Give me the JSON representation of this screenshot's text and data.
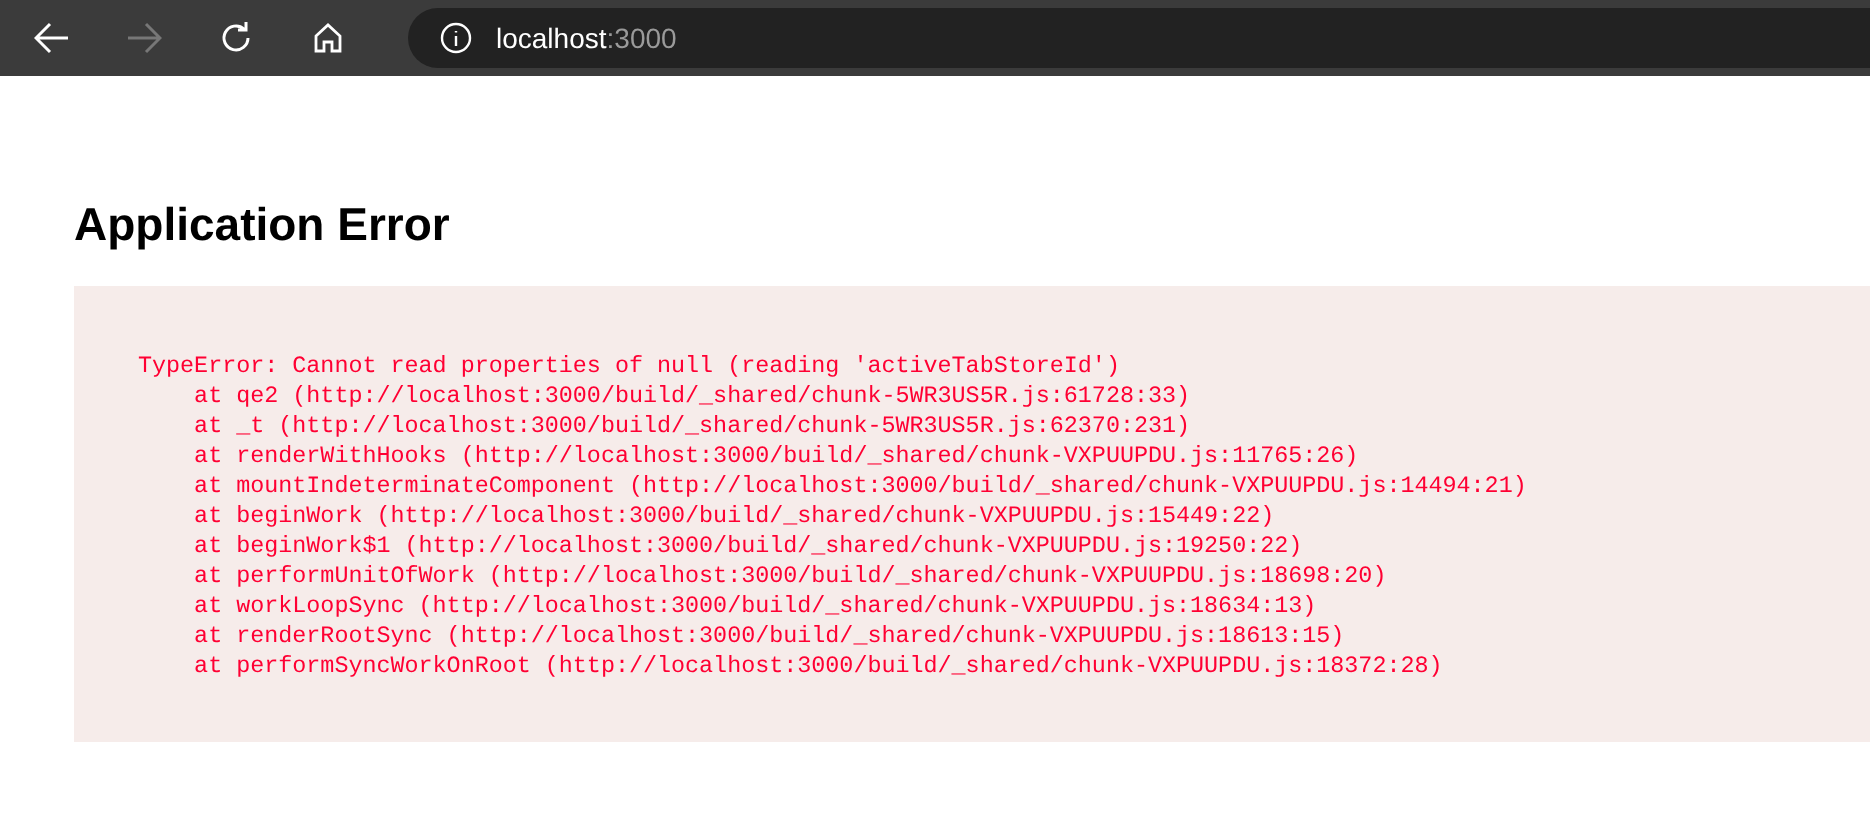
{
  "browser": {
    "address_host": "localhost",
    "address_port": ":3000",
    "forward_disabled": true
  },
  "heading": "Application Error",
  "error_lines": [
    "TypeError: Cannot read properties of null (reading 'activeTabStoreId')",
    "    at qe2 (http://localhost:3000/build/_shared/chunk-5WR3US5R.js:61728:33)",
    "    at _t (http://localhost:3000/build/_shared/chunk-5WR3US5R.js:62370:231)",
    "    at renderWithHooks (http://localhost:3000/build/_shared/chunk-VXPUUPDU.js:11765:26)",
    "    at mountIndeterminateComponent (http://localhost:3000/build/_shared/chunk-VXPUUPDU.js:14494:21)",
    "    at beginWork (http://localhost:3000/build/_shared/chunk-VXPUUPDU.js:15449:22)",
    "    at beginWork$1 (http://localhost:3000/build/_shared/chunk-VXPUUPDU.js:19250:22)",
    "    at performUnitOfWork (http://localhost:3000/build/_shared/chunk-VXPUUPDU.js:18698:20)",
    "    at workLoopSync (http://localhost:3000/build/_shared/chunk-VXPUUPDU.js:18634:13)",
    "    at renderRootSync (http://localhost:3000/build/_shared/chunk-VXPUUPDU.js:18613:15)",
    "    at performSyncWorkOnRoot (http://localhost:3000/build/_shared/chunk-VXPUUPDU.js:18372:28)"
  ]
}
